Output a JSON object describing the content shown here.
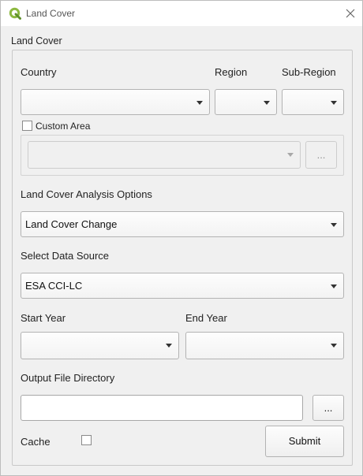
{
  "window": {
    "title": "Land Cover",
    "icon": "qgis-icon",
    "close_icon": "close-icon"
  },
  "group": {
    "title": "Land Cover"
  },
  "location": {
    "country_label": "Country",
    "region_label": "Region",
    "subregion_label": "Sub-Region",
    "country_value": "",
    "region_value": "",
    "subregion_value": ""
  },
  "custom_area": {
    "label": "Custom Area",
    "checked": false,
    "value": "",
    "browse_label": "..."
  },
  "analysis": {
    "label": "Land Cover Analysis Options",
    "value": "Land Cover Change"
  },
  "data_source": {
    "label": "Select Data Source",
    "value": "ESA CCI-LC"
  },
  "years": {
    "start_label": "Start Year",
    "end_label": "End Year",
    "start_value": "",
    "end_value": ""
  },
  "output": {
    "label": "Output File Directory",
    "value": "",
    "browse_label": "..."
  },
  "cache": {
    "label": "Cache",
    "checked": false
  },
  "submit": {
    "label": "Submit"
  }
}
